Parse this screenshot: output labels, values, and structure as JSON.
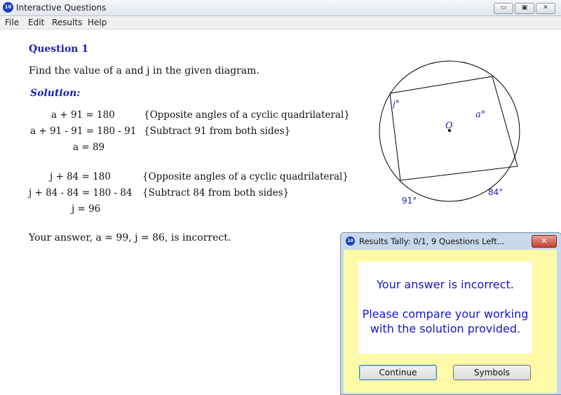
{
  "window": {
    "title": "Interactive Questions",
    "app_icon_text": "10",
    "buttons": {
      "minimize": "▭",
      "maximize": "▣",
      "close": "✕"
    }
  },
  "menu": [
    "File",
    "Edit",
    "Results",
    "Help"
  ],
  "question": {
    "title": "Question 1",
    "text": "Find the value of a and j in the given diagram.",
    "solution_label": "Solution:",
    "lines_a": [
      {
        "expr": "a + 91 = 180",
        "reason": "{Opposite angles of a cyclic quadrilateral}"
      },
      {
        "expr": "a + 91 - 91 = 180 - 91",
        "reason": "{Subtract 91 from both sides}"
      },
      {
        "expr": "a = 89",
        "reason": ""
      }
    ],
    "lines_j": [
      {
        "expr": "j + 84 = 180",
        "reason": "{Opposite angles of a cyclic quadrilateral}"
      },
      {
        "expr": "j + 84 - 84 = 180 - 84",
        "reason": "{Subtract 84 from both sides}"
      },
      {
        "expr": "j = 96",
        "reason": ""
      }
    ],
    "answer_feedback": "Your answer, a = 99, j = 86, is incorrect."
  },
  "diagram": {
    "labels": {
      "a": "a°",
      "j": "j°",
      "center": "O",
      "angle_84": "84°",
      "angle_91": "91°"
    }
  },
  "dialog": {
    "title": "Results Tally:  0/1, 9 Questions Left...",
    "close": "✕",
    "message_1": "Your answer is incorrect.",
    "message_2": "Please compare your working",
    "message_3": "with the solution provided.",
    "continue_label": "Continue",
    "symbols_label": "Symbols"
  }
}
